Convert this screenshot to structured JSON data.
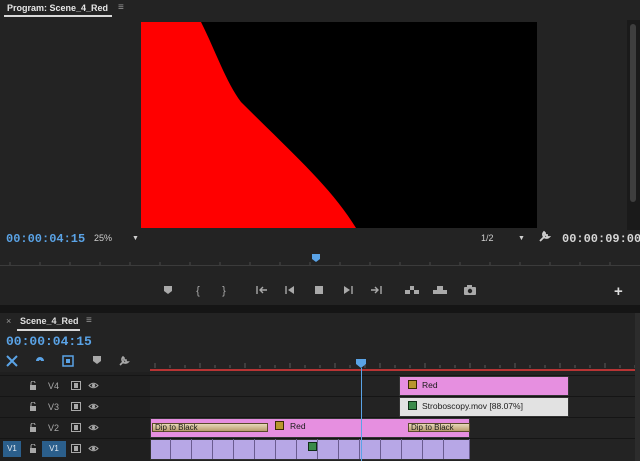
{
  "program_monitor": {
    "title": "Program: Scene_4_Red",
    "menu_icon": "≡",
    "current_timecode": "00:00:04:15",
    "duration_timecode": "00:00:09:00",
    "zoom": "25%",
    "resolution": "1/2",
    "transport": [
      "marker-icon",
      "mark-in-icon",
      "mark-out-icon",
      "go-to-in-icon",
      "step-back-icon",
      "stop-icon",
      "step-forward-icon",
      "go-to-out-icon",
      "insert-icon",
      "overwrite-icon",
      "camera-icon"
    ],
    "add_label": "+",
    "colors": {
      "red_shape": "#ff0000",
      "viewer_bg": "#000000",
      "timecode_blue": "#5aa3e6"
    }
  },
  "timeline": {
    "close_label": "×",
    "title": "Scene_4_Red",
    "menu_icon": "≡",
    "timecode": "00:00:04:15",
    "tracks": [
      {
        "name": "V4"
      },
      {
        "name": "V3"
      },
      {
        "name": "V2"
      },
      {
        "name": "V1",
        "source": "V1"
      }
    ],
    "clips": {
      "v4_red_label": "Red",
      "v3_strob_label": "Stroboscopy.mov [88.07%]",
      "v2_red_label": "Red",
      "v2_transition_left": "Dip to Black",
      "v2_transition_right": "Dip to Black"
    },
    "colors": {
      "clip_pink": "#e68fe0",
      "clip_white": "#e2e2e2",
      "clip_purple": "#b7a7e6",
      "ruler_red": "#b83434"
    }
  }
}
